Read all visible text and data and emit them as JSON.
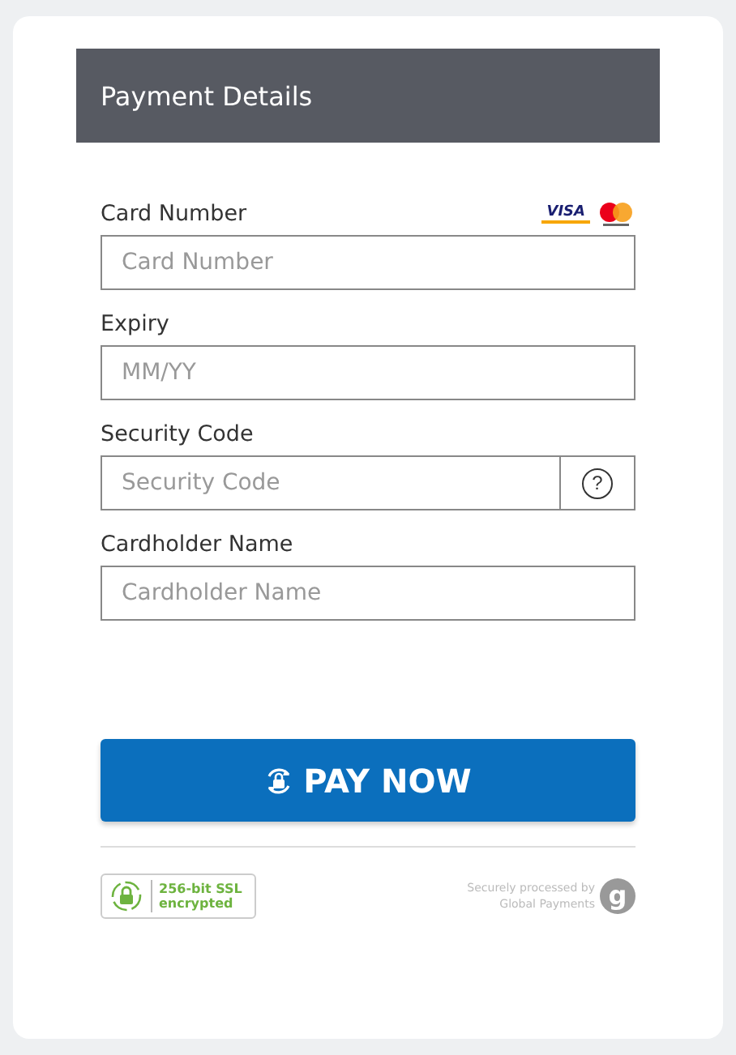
{
  "header": {
    "title": "Payment Details"
  },
  "card_brands": {
    "visa": "VISA"
  },
  "fields": [
    {
      "label": "Card Number",
      "placeholder": "Card Number",
      "kind": "card"
    },
    {
      "label": "Expiry",
      "placeholder": "MM/YY",
      "kind": "text"
    },
    {
      "label": "Security Code",
      "placeholder": "Security Code",
      "kind": "cvv",
      "help": "?"
    },
    {
      "label": "Cardholder Name",
      "placeholder": "Cardholder Name",
      "kind": "text"
    }
  ],
  "pay_button": "PAY NOW",
  "ssl_badge": {
    "line1": "256-bit SSL",
    "line2": "encrypted"
  },
  "processor": {
    "line1": "Securely processed by",
    "line2": "Global Payments",
    "logo": "g"
  }
}
